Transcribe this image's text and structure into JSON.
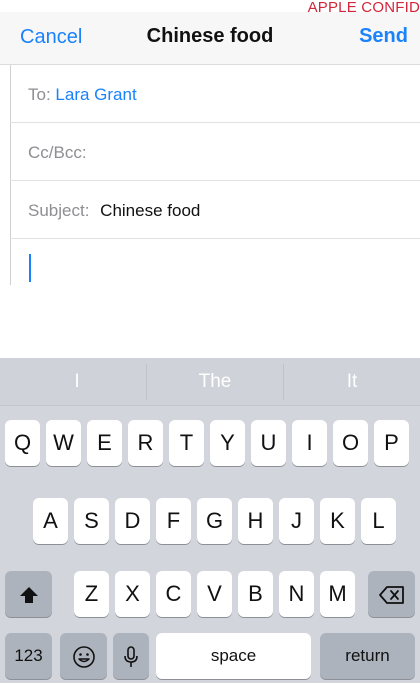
{
  "watermark": "APPLE CONFID",
  "navbar": {
    "cancel": "Cancel",
    "title": "Chinese food",
    "send": "Send"
  },
  "fields": {
    "to_label": "To:",
    "to_value": "Lara Grant",
    "ccbcc_label": "Cc/Bcc:",
    "subject_label": "Subject:",
    "subject_value": "Chinese food"
  },
  "suggestions": [
    "I",
    "The",
    "It"
  ],
  "keyboard": {
    "row1": [
      "Q",
      "W",
      "E",
      "R",
      "T",
      "Y",
      "U",
      "I",
      "O",
      "P"
    ],
    "row2": [
      "A",
      "S",
      "D",
      "F",
      "G",
      "H",
      "J",
      "K",
      "L"
    ],
    "row3": [
      "Z",
      "X",
      "C",
      "V",
      "B",
      "N",
      "M"
    ],
    "numbers_label": "123",
    "space_label": "space",
    "return_label": "return"
  },
  "colors": {
    "accent": "#1a82fb",
    "watermark": "#d2263a"
  }
}
